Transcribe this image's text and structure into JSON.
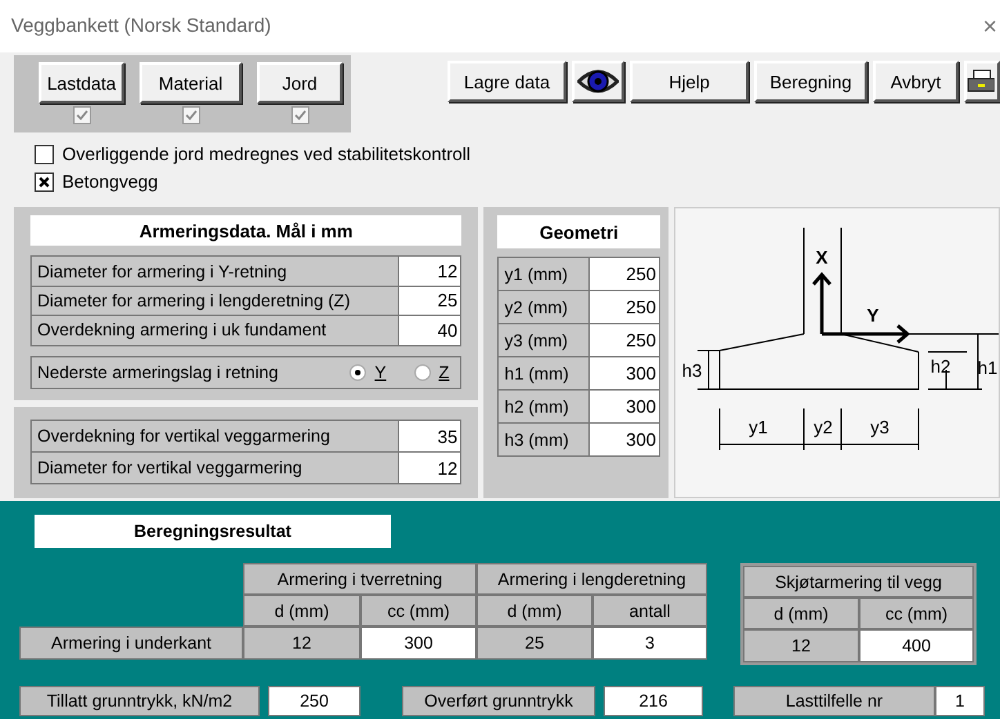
{
  "window": {
    "title": "Veggbankett (Norsk Standard)",
    "close": "×"
  },
  "data_buttons": [
    {
      "label": "Lastdata",
      "checked": true,
      "disabled": true
    },
    {
      "label": "Material",
      "checked": true,
      "disabled": true
    },
    {
      "label": "Jord",
      "checked": true,
      "disabled": true
    }
  ],
  "toolbar": [
    {
      "kind": "text",
      "label": "Lagre data"
    },
    {
      "kind": "eye"
    },
    {
      "kind": "text",
      "label": "Hjelp"
    },
    {
      "kind": "text",
      "label": "Beregning"
    },
    {
      "kind": "text",
      "label": "Avbryt"
    },
    {
      "kind": "printer"
    }
  ],
  "options": [
    {
      "label": "Overliggende jord medregnes ved stabilitetskontroll",
      "checked": false
    },
    {
      "label": "Betongvegg",
      "checked": true
    }
  ],
  "reinforcement": {
    "title": "Armeringsdata.  Mål i mm",
    "fields": [
      {
        "label": "Diameter for armering i Y-retning",
        "value": "12"
      },
      {
        "label": "Diameter for armering i lengderetning  (Z)",
        "value": "25"
      },
      {
        "label": "Overdekning armering i uk fundament",
        "value": "40"
      }
    ],
    "layer": {
      "label": "Nederste armeringslag i retning",
      "options": [
        {
          "label": "Y",
          "selected": true
        },
        {
          "label": "Z",
          "selected": false
        }
      ]
    }
  },
  "wall": {
    "fields": [
      {
        "label": "Overdekning for vertikal veggarmering",
        "value": "35"
      },
      {
        "label": "Diameter for vertikal veggarmering",
        "value": "12"
      }
    ]
  },
  "geometry": {
    "title": "Geometri",
    "fields": [
      {
        "label": "y1 (mm)",
        "value": "250"
      },
      {
        "label": "y2 (mm)",
        "value": "250"
      },
      {
        "label": "y3 (mm)",
        "value": "250"
      },
      {
        "label": "h1 (mm)",
        "value": "300"
      },
      {
        "label": "h2 (mm)",
        "value": "300"
      },
      {
        "label": "h3 (mm)",
        "value": "300"
      }
    ]
  },
  "diagram": {
    "x_axis": "X",
    "y_axis": "Y",
    "h1": "h1",
    "h2": "h2",
    "h3": "h3",
    "y1": "y1",
    "y2": "y2",
    "y3": "y3"
  },
  "results": {
    "title": "Beregningsresultat",
    "main_table": {
      "groups": [
        "Armering i tverretning",
        "Armering i lengderetning"
      ],
      "columns": [
        "d (mm)",
        "cc (mm)",
        "d (mm)",
        "antall"
      ],
      "row": {
        "label": "Armering i underkant",
        "values": [
          "12",
          "300",
          "25",
          "3"
        ]
      }
    },
    "splice_table": {
      "title": "Skjøtarmering til vegg",
      "columns": [
        "d (mm)",
        "cc (mm)"
      ],
      "values": [
        "12",
        "400"
      ]
    },
    "bottom": [
      {
        "label": "Tillatt grunntrykk, kN/m2",
        "value": "250"
      },
      {
        "label": "Overført grunntrykk",
        "value": "216"
      },
      {
        "label": "Lasttilfelle nr",
        "value": "1"
      }
    ]
  }
}
